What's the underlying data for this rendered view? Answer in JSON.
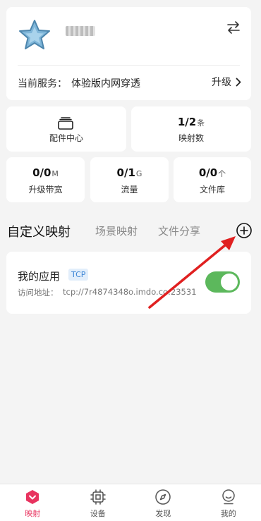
{
  "account": {
    "service_label": "当前服务：",
    "service_value": "体验版内网穿透",
    "upgrade_label": "升级"
  },
  "stats": {
    "parts_center": {
      "label": "配件中心"
    },
    "mapping_count": {
      "value": "1/2",
      "unit": "条",
      "label": "映射数"
    },
    "bandwidth": {
      "value": "0/0",
      "unit": "M",
      "label": "升级带宽"
    },
    "traffic": {
      "value": "0/1",
      "unit": "G",
      "label": "流量"
    },
    "file_library": {
      "value": "0/0",
      "unit": "个",
      "label": "文件库"
    }
  },
  "tabs": [
    {
      "label": "自定义映射",
      "active": true
    },
    {
      "label": "场景映射",
      "active": false
    },
    {
      "label": "文件分享",
      "active": false
    }
  ],
  "mapping": {
    "name": "我的应用",
    "protocol": "TCP",
    "access_label": "访问地址：",
    "access_address": "tcp://7r4874348o.imdo.co:23531",
    "enabled": true
  },
  "nav": [
    {
      "label": "映射",
      "icon": "mapping-icon",
      "active": true
    },
    {
      "label": "设备",
      "icon": "device-icon",
      "active": false
    },
    {
      "label": "发现",
      "icon": "discover-icon",
      "active": false
    },
    {
      "label": "我的",
      "icon": "profile-icon",
      "active": false
    }
  ],
  "colors": {
    "accent": "#e8335f",
    "toggle_on": "#5cb85c",
    "badge_text": "#3d86d6",
    "annotation_arrow": "#e02020"
  }
}
